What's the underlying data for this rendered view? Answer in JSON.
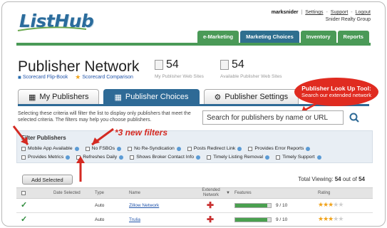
{
  "brand": {
    "logo_text": "ListHub"
  },
  "userbar": {
    "username": "marksnider",
    "links": [
      "Settings",
      "Support",
      "Logout"
    ],
    "company": "Snider Realty Group"
  },
  "topnav": [
    "e-Marketing",
    "Marketing Choices",
    "Inventory",
    "Reports"
  ],
  "page": {
    "title": "Publisher Network",
    "sublinks": [
      "Scorecard Flip-Book",
      "Scorecard Comparison"
    ]
  },
  "stats": [
    {
      "value": "54",
      "label": "My Publisher Web Sites"
    },
    {
      "value": "54",
      "label": "Available Publisher Web Sites"
    }
  ],
  "tabs": [
    "My Publishers",
    "Publisher Choices",
    "Publisher Settings"
  ],
  "callout": {
    "title": "Publisher Look Up Tool:",
    "text": "Search our extended network"
  },
  "description": "Selecting these criteria will filter the list to display only publishers that meet the selected criteria. The filters may help you choose publishers.",
  "search": {
    "placeholder": "Search for publishers by name or URL"
  },
  "filters": {
    "heading": "Filter Publishers",
    "row1": [
      "Mobile App Available",
      "No FSBOs",
      "No Re-Syndication",
      "Posts Redirect Link",
      "Provides Error Reports"
    ],
    "row2": [
      "Provides Metrics",
      "Refreshes Daily",
      "Shows Broker Contact Info",
      "Timely Listing Removal",
      "Timely Support"
    ]
  },
  "annotation": {
    "new_filters": "*3 new filters"
  },
  "actions": {
    "add_selected": "Add Selected"
  },
  "total": {
    "prefix": "Total Viewing:",
    "count": "54",
    "middle": "out of",
    "of": "54"
  },
  "table": {
    "headers": [
      "Date Selected",
      "Type",
      "Name",
      "Extended Network",
      "Features",
      "Rating"
    ],
    "rows": [
      {
        "type": "Auto",
        "name": "Zillow Network",
        "features": "9 / 10",
        "feature_fraction": 0.9,
        "rating": 3,
        "rating_max": 5
      },
      {
        "type": "Auto",
        "name": "Trulia",
        "features": "9 / 10",
        "feature_fraction": 0.9,
        "rating": 3,
        "rating_max": 5
      }
    ]
  },
  "colors": {
    "accent_green": "#4a9a57",
    "accent_blue": "#2e6a96",
    "callout_red": "#e02b20"
  }
}
